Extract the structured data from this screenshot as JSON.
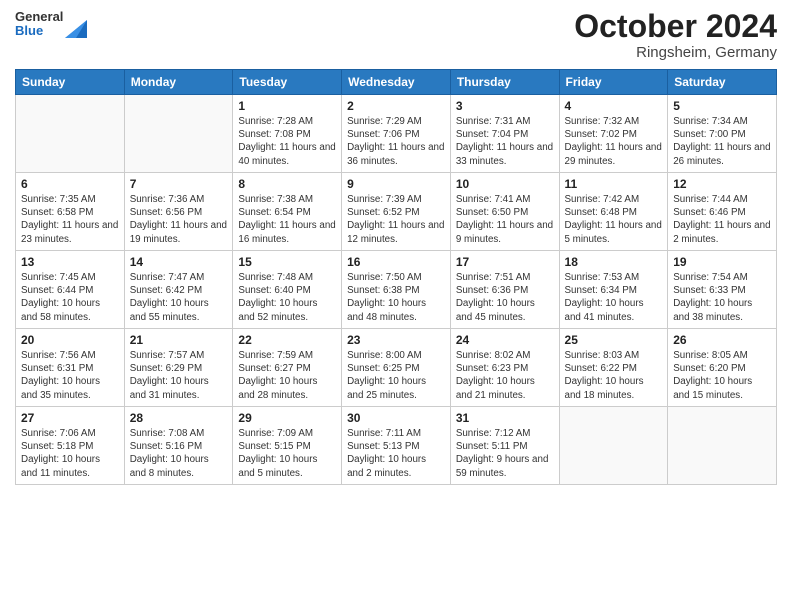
{
  "header": {
    "logo_general": "General",
    "logo_blue": "Blue",
    "month_title": "October 2024",
    "location": "Ringsheim, Germany"
  },
  "days_of_week": [
    "Sunday",
    "Monday",
    "Tuesday",
    "Wednesday",
    "Thursday",
    "Friday",
    "Saturday"
  ],
  "weeks": [
    [
      {
        "day": "",
        "info": ""
      },
      {
        "day": "",
        "info": ""
      },
      {
        "day": "1",
        "info": "Sunrise: 7:28 AM\nSunset: 7:08 PM\nDaylight: 11 hours and 40 minutes."
      },
      {
        "day": "2",
        "info": "Sunrise: 7:29 AM\nSunset: 7:06 PM\nDaylight: 11 hours and 36 minutes."
      },
      {
        "day": "3",
        "info": "Sunrise: 7:31 AM\nSunset: 7:04 PM\nDaylight: 11 hours and 33 minutes."
      },
      {
        "day": "4",
        "info": "Sunrise: 7:32 AM\nSunset: 7:02 PM\nDaylight: 11 hours and 29 minutes."
      },
      {
        "day": "5",
        "info": "Sunrise: 7:34 AM\nSunset: 7:00 PM\nDaylight: 11 hours and 26 minutes."
      }
    ],
    [
      {
        "day": "6",
        "info": "Sunrise: 7:35 AM\nSunset: 6:58 PM\nDaylight: 11 hours and 23 minutes."
      },
      {
        "day": "7",
        "info": "Sunrise: 7:36 AM\nSunset: 6:56 PM\nDaylight: 11 hours and 19 minutes."
      },
      {
        "day": "8",
        "info": "Sunrise: 7:38 AM\nSunset: 6:54 PM\nDaylight: 11 hours and 16 minutes."
      },
      {
        "day": "9",
        "info": "Sunrise: 7:39 AM\nSunset: 6:52 PM\nDaylight: 11 hours and 12 minutes."
      },
      {
        "day": "10",
        "info": "Sunrise: 7:41 AM\nSunset: 6:50 PM\nDaylight: 11 hours and 9 minutes."
      },
      {
        "day": "11",
        "info": "Sunrise: 7:42 AM\nSunset: 6:48 PM\nDaylight: 11 hours and 5 minutes."
      },
      {
        "day": "12",
        "info": "Sunrise: 7:44 AM\nSunset: 6:46 PM\nDaylight: 11 hours and 2 minutes."
      }
    ],
    [
      {
        "day": "13",
        "info": "Sunrise: 7:45 AM\nSunset: 6:44 PM\nDaylight: 10 hours and 58 minutes."
      },
      {
        "day": "14",
        "info": "Sunrise: 7:47 AM\nSunset: 6:42 PM\nDaylight: 10 hours and 55 minutes."
      },
      {
        "day": "15",
        "info": "Sunrise: 7:48 AM\nSunset: 6:40 PM\nDaylight: 10 hours and 52 minutes."
      },
      {
        "day": "16",
        "info": "Sunrise: 7:50 AM\nSunset: 6:38 PM\nDaylight: 10 hours and 48 minutes."
      },
      {
        "day": "17",
        "info": "Sunrise: 7:51 AM\nSunset: 6:36 PM\nDaylight: 10 hours and 45 minutes."
      },
      {
        "day": "18",
        "info": "Sunrise: 7:53 AM\nSunset: 6:34 PM\nDaylight: 10 hours and 41 minutes."
      },
      {
        "day": "19",
        "info": "Sunrise: 7:54 AM\nSunset: 6:33 PM\nDaylight: 10 hours and 38 minutes."
      }
    ],
    [
      {
        "day": "20",
        "info": "Sunrise: 7:56 AM\nSunset: 6:31 PM\nDaylight: 10 hours and 35 minutes."
      },
      {
        "day": "21",
        "info": "Sunrise: 7:57 AM\nSunset: 6:29 PM\nDaylight: 10 hours and 31 minutes."
      },
      {
        "day": "22",
        "info": "Sunrise: 7:59 AM\nSunset: 6:27 PM\nDaylight: 10 hours and 28 minutes."
      },
      {
        "day": "23",
        "info": "Sunrise: 8:00 AM\nSunset: 6:25 PM\nDaylight: 10 hours and 25 minutes."
      },
      {
        "day": "24",
        "info": "Sunrise: 8:02 AM\nSunset: 6:23 PM\nDaylight: 10 hours and 21 minutes."
      },
      {
        "day": "25",
        "info": "Sunrise: 8:03 AM\nSunset: 6:22 PM\nDaylight: 10 hours and 18 minutes."
      },
      {
        "day": "26",
        "info": "Sunrise: 8:05 AM\nSunset: 6:20 PM\nDaylight: 10 hours and 15 minutes."
      }
    ],
    [
      {
        "day": "27",
        "info": "Sunrise: 7:06 AM\nSunset: 5:18 PM\nDaylight: 10 hours and 11 minutes."
      },
      {
        "day": "28",
        "info": "Sunrise: 7:08 AM\nSunset: 5:16 PM\nDaylight: 10 hours and 8 minutes."
      },
      {
        "day": "29",
        "info": "Sunrise: 7:09 AM\nSunset: 5:15 PM\nDaylight: 10 hours and 5 minutes."
      },
      {
        "day": "30",
        "info": "Sunrise: 7:11 AM\nSunset: 5:13 PM\nDaylight: 10 hours and 2 minutes."
      },
      {
        "day": "31",
        "info": "Sunrise: 7:12 AM\nSunset: 5:11 PM\nDaylight: 9 hours and 59 minutes."
      },
      {
        "day": "",
        "info": ""
      },
      {
        "day": "",
        "info": ""
      }
    ]
  ]
}
